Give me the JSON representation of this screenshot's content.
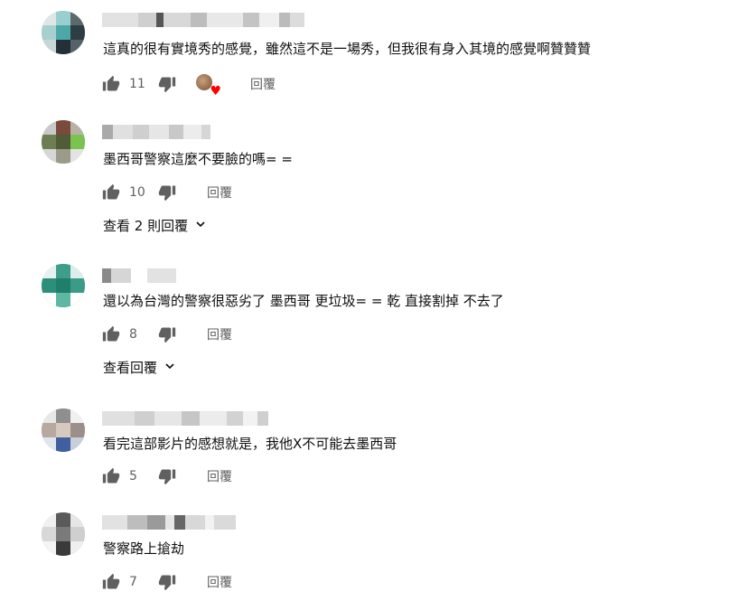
{
  "comments": [
    {
      "text": "這真的很有實境秀的感覺，雖然這不是一場秀，但我很有身入其境的感覺啊贊贊贊",
      "likes": "11",
      "reply_label": "回覆",
      "creator_heart": true
    },
    {
      "text": "墨西哥警察這麼不要臉的嗎= =",
      "likes": "10",
      "reply_label": "回覆",
      "view_replies": "查看 2 則回覆"
    },
    {
      "text": "還以為台灣的警察很惡劣了 墨西哥 更垃圾= = 乾 直接割掉 不去了",
      "likes": "8",
      "reply_label": "回覆",
      "view_replies": "查看回覆"
    },
    {
      "text": "看完這部影片的感想就是，我他X不可能去墨西哥",
      "likes": "5",
      "reply_label": "回覆"
    },
    {
      "text": "警察路上搶劫",
      "likes": "7",
      "reply_label": "回覆"
    }
  ],
  "icons": {
    "like": "thumb-up-icon",
    "dislike": "thumb-down-icon",
    "heart": "heart-icon",
    "expand": "chevron-down-icon"
  },
  "colors": {
    "text": "#0f0f0f",
    "secondary": "#606060",
    "heart": "#ff0000"
  }
}
